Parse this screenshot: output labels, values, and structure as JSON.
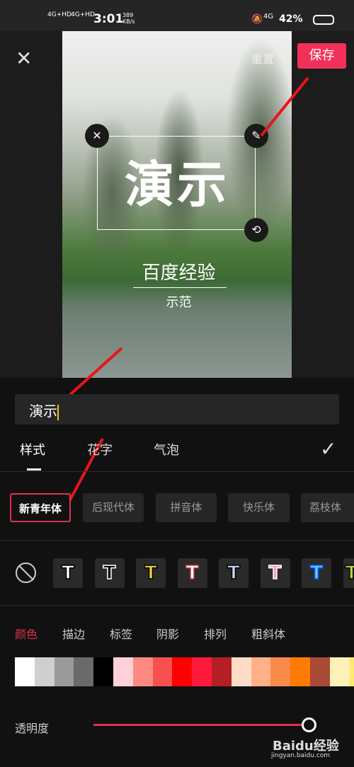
{
  "status": {
    "network1": "4G+HD",
    "network2": "4G+HD",
    "time": "3:01",
    "speed": "389 KB/s",
    "net": "4G",
    "battery": "42%"
  },
  "toolbar": {
    "reset_label": "重置",
    "save_label": "保存"
  },
  "preview": {
    "main_text": "演示",
    "subtitle": "百度经验",
    "caption": "示范"
  },
  "input": {
    "value": "演示"
  },
  "tabs": [
    {
      "label": "样式"
    },
    {
      "label": "花字"
    },
    {
      "label": "气泡"
    }
  ],
  "fonts": [
    "新青年体",
    "后现代体",
    "拼音体",
    "快乐体",
    "荔枝体"
  ],
  "text_styles": [
    {
      "fill": "#ffffff",
      "stroke": "#000000"
    },
    {
      "fill": "#000000",
      "stroke": "#ffffff"
    },
    {
      "fill": "#f0d040",
      "stroke": "#000000"
    },
    {
      "fill": "#ffffff",
      "stroke": "#c04050"
    },
    {
      "fill": "#c8d8f8",
      "stroke": "#000000"
    },
    {
      "fill": "#f5a0c0",
      "stroke": "#ffffff"
    },
    {
      "fill": "#60c8ff",
      "stroke": "#0060ff"
    },
    {
      "fill": "#c0d040",
      "stroke": "#000000"
    }
  ],
  "color_tabs": [
    {
      "label": "颜色",
      "active": true
    },
    {
      "label": "描边"
    },
    {
      "label": "标签"
    },
    {
      "label": "阴影"
    },
    {
      "label": "排列"
    },
    {
      "label": "粗斜体"
    }
  ],
  "swatches": [
    "#ffffff",
    "#cfcfcf",
    "#9a9a9a",
    "#6a6a6a",
    "#000000",
    "#ffd0da",
    "#fd8a80",
    "#f85050",
    "#ff0000",
    "#ff1a3c",
    "#b51e22",
    "#ffdcc8",
    "#ffb088",
    "#f98a4a",
    "#ff7a00",
    "#a84a35",
    "#fdf0b8",
    "#ffe870"
  ],
  "opacity": {
    "label": "透明度",
    "value": 1.0
  },
  "watermark": {
    "brand": "Bai du 经验",
    "url": "jingyan.baidu.com"
  },
  "accent": "#f2315b"
}
